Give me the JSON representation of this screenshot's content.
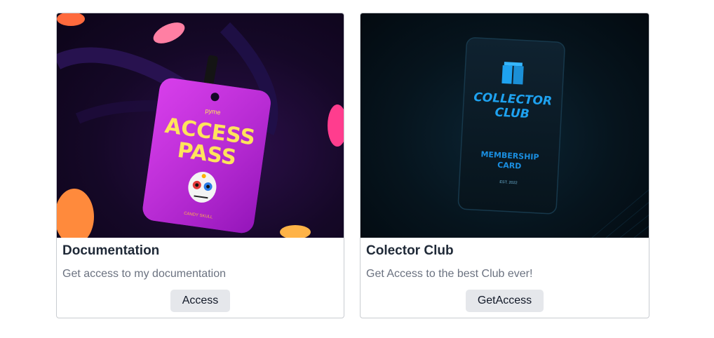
{
  "cards": [
    {
      "image_alt": "Access pass badge",
      "badge_brand": "pyme",
      "badge_line1": "ACCESS",
      "badge_line2": "PASS",
      "badge_footer": "CANDY SKULL",
      "title": "Documentation",
      "description": "Get access to my documentation",
      "button_label": "Access"
    },
    {
      "image_alt": "Collector Club membership card",
      "card_line1": "COLLECTOR",
      "card_line2": "CLUB",
      "card_line3": "MEMBERSHIP",
      "card_line4": "CARD",
      "card_est": "EST. 2022",
      "title": "Colector Club",
      "description": "Get Access to the best Club ever!",
      "button_label": "GetAccess"
    }
  ],
  "colors": {
    "button_bg": "#e5e7eb",
    "title": "#1f2937",
    "description": "#6b7280",
    "badge_magenta": "#c21ee0",
    "badge_yellow": "#ffe45c",
    "club_blue": "#1ea2f0"
  }
}
